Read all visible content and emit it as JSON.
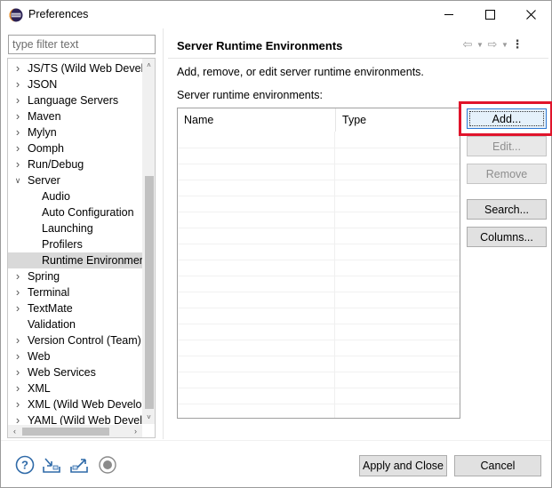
{
  "window": {
    "title": "Preferences",
    "controls": {
      "minimize_icon": "minimize-icon",
      "maximize_icon": "maximize-icon",
      "close_icon": "close-icon"
    }
  },
  "filter": {
    "placeholder": "type filter text",
    "value": ""
  },
  "tree": {
    "items": [
      {
        "label": "JS/TS (Wild Web Develo",
        "expandable": true,
        "expanded": false,
        "level": 0
      },
      {
        "label": "JSON",
        "expandable": true,
        "expanded": false,
        "level": 0
      },
      {
        "label": "Language Servers",
        "expandable": true,
        "expanded": false,
        "level": 0
      },
      {
        "label": "Maven",
        "expandable": true,
        "expanded": false,
        "level": 0
      },
      {
        "label": "Mylyn",
        "expandable": true,
        "expanded": false,
        "level": 0
      },
      {
        "label": "Oomph",
        "expandable": true,
        "expanded": false,
        "level": 0
      },
      {
        "label": "Run/Debug",
        "expandable": true,
        "expanded": false,
        "level": 0
      },
      {
        "label": "Server",
        "expandable": true,
        "expanded": true,
        "level": 0
      },
      {
        "label": "Audio",
        "expandable": false,
        "expanded": false,
        "level": 1
      },
      {
        "label": "Auto Configuration",
        "expandable": false,
        "expanded": false,
        "level": 1
      },
      {
        "label": "Launching",
        "expandable": false,
        "expanded": false,
        "level": 1
      },
      {
        "label": "Profilers",
        "expandable": false,
        "expanded": false,
        "level": 1
      },
      {
        "label": "Runtime Environmen",
        "expandable": false,
        "expanded": false,
        "level": 1,
        "selected": true
      },
      {
        "label": "Spring",
        "expandable": true,
        "expanded": false,
        "level": 0
      },
      {
        "label": "Terminal",
        "expandable": true,
        "expanded": false,
        "level": 0
      },
      {
        "label": "TextMate",
        "expandable": true,
        "expanded": false,
        "level": 0
      },
      {
        "label": "Validation",
        "expandable": false,
        "expanded": false,
        "level": 0
      },
      {
        "label": "Version Control (Team)",
        "expandable": true,
        "expanded": false,
        "level": 0
      },
      {
        "label": "Web",
        "expandable": true,
        "expanded": false,
        "level": 0
      },
      {
        "label": "Web Services",
        "expandable": true,
        "expanded": false,
        "level": 0
      },
      {
        "label": "XML",
        "expandable": true,
        "expanded": false,
        "level": 0
      },
      {
        "label": "XML (Wild Web Develop",
        "expandable": true,
        "expanded": false,
        "level": 0
      },
      {
        "label": "YAML (Wild Web Devel",
        "expandable": true,
        "expanded": false,
        "level": 0
      }
    ]
  },
  "page": {
    "title": "Server Runtime Environments",
    "description": "Add, remove, or edit server runtime environments.",
    "table_label": "Server runtime environments:",
    "table": {
      "columns": [
        "Name",
        "Type"
      ],
      "rows": []
    },
    "nav": {
      "back_icon": "back-arrow-icon",
      "forward_icon": "forward-arrow-icon",
      "menu_icon": "more-vertical-icon"
    }
  },
  "buttons": {
    "add": {
      "label": "Add...",
      "enabled": true,
      "focused": true
    },
    "edit": {
      "label": "Edit...",
      "enabled": false
    },
    "remove": {
      "label": "Remove",
      "enabled": false
    },
    "search": {
      "label": "Search...",
      "enabled": true
    },
    "columns": {
      "label": "Columns...",
      "enabled": true
    }
  },
  "footer": {
    "icons": [
      "help-icon",
      "import-icon",
      "export-icon",
      "record-icon"
    ],
    "apply_close_label": "Apply and Close",
    "cancel_label": "Cancel"
  },
  "colors": {
    "highlight": "#e0142b",
    "focus": "#2c78d4",
    "selection": "#d9d9d9"
  }
}
